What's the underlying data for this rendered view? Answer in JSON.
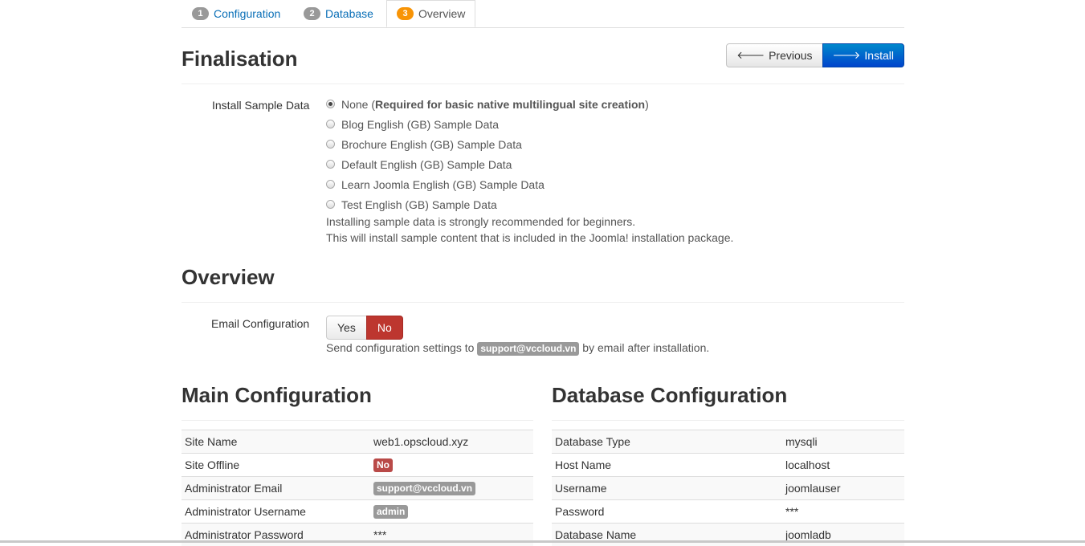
{
  "tabs": [
    {
      "num": "1",
      "label": "Configuration"
    },
    {
      "num": "2",
      "label": "Database"
    },
    {
      "num": "3",
      "label": "Overview"
    }
  ],
  "finalisation": {
    "title": "Finalisation",
    "previous_label": "Previous",
    "install_label": "Install",
    "sample_data_label": "Install Sample Data",
    "options": {
      "none_prefix": "None (",
      "none_bold": "Required for basic native multilingual site creation",
      "none_suffix": ")",
      "blog": "Blog English (GB) Sample Data",
      "brochure": "Brochure English (GB) Sample Data",
      "default": "Default English (GB) Sample Data",
      "learn": "Learn Joomla English (GB) Sample Data",
      "test": "Test English (GB) Sample Data"
    },
    "help_line1": "Installing sample data is strongly recommended for beginners.",
    "help_line2": "This will install sample content that is included in the Joomla! installation package."
  },
  "overview": {
    "title": "Overview",
    "email_label": "Email Configuration",
    "yes": "Yes",
    "no": "No",
    "send_prefix": "Send configuration settings to",
    "send_email": "support@vccloud.vn",
    "send_suffix": "by email after installation."
  },
  "main_config": {
    "title": "Main Configuration",
    "rows": {
      "site_name": {
        "label": "Site Name",
        "value": "web1.opscloud.xyz"
      },
      "site_offline": {
        "label": "Site Offline",
        "value": "No"
      },
      "admin_email": {
        "label": "Administrator Email",
        "value": "support@vccloud.vn"
      },
      "admin_username": {
        "label": "Administrator Username",
        "value": "admin"
      },
      "admin_password": {
        "label": "Administrator Password",
        "value": "***"
      }
    }
  },
  "db_config": {
    "title": "Database Configuration",
    "rows": {
      "type": {
        "label": "Database Type",
        "value": "mysqli"
      },
      "host": {
        "label": "Host Name",
        "value": "localhost"
      },
      "username": {
        "label": "Username",
        "value": "joomlauser"
      },
      "password": {
        "label": "Password",
        "value": "***"
      },
      "name": {
        "label": "Database Name",
        "value": "joomladb"
      }
    }
  },
  "colors": {
    "accent": "#0a6fb7",
    "install_button": "#0055cc",
    "no_button": "#bd362f",
    "active_step": "#f89406"
  }
}
